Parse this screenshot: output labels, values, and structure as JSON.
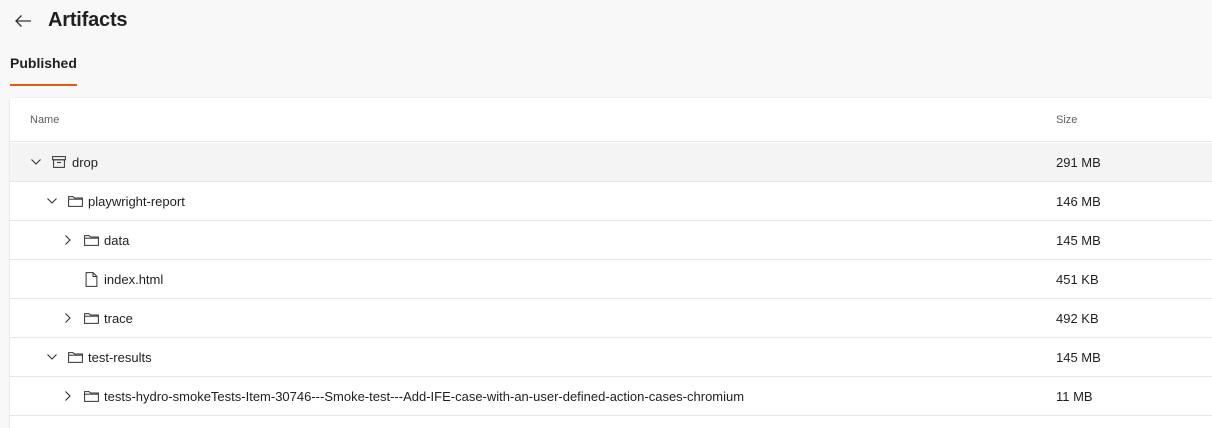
{
  "header": {
    "title": "Artifacts",
    "back_icon": "arrow-left-icon"
  },
  "tabs": [
    {
      "label": "Published",
      "selected": true
    }
  ],
  "columns": {
    "name": "Name",
    "size": "Size"
  },
  "rows": [
    {
      "name": "drop",
      "size": "291 MB",
      "level": 0,
      "expander": "expanded",
      "icon": "archive-icon",
      "selected": true
    },
    {
      "name": "playwright-report",
      "size": "146 MB",
      "level": 1,
      "expander": "expanded",
      "icon": "folder-icon"
    },
    {
      "name": "data",
      "size": "145 MB",
      "level": 2,
      "expander": "collapsed",
      "icon": "folder-icon"
    },
    {
      "name": "index.html",
      "size": "451 KB",
      "level": 2,
      "expander": "none",
      "icon": "file-icon"
    },
    {
      "name": "trace",
      "size": "492 KB",
      "level": 2,
      "expander": "collapsed",
      "icon": "folder-icon"
    },
    {
      "name": "test-results",
      "size": "145 MB",
      "level": 1,
      "expander": "expanded",
      "icon": "folder-icon"
    },
    {
      "name": "tests-hydro-smokeTests-Item-30746---Smoke-test---Add-IFE-case-with-an-user-defined-action-cases-chromium",
      "size": "11 MB",
      "level": 2,
      "expander": "collapsed",
      "icon": "folder-icon"
    }
  ],
  "colors": {
    "accent": "#e05e0d",
    "selected_row": "#f4f4f4"
  }
}
